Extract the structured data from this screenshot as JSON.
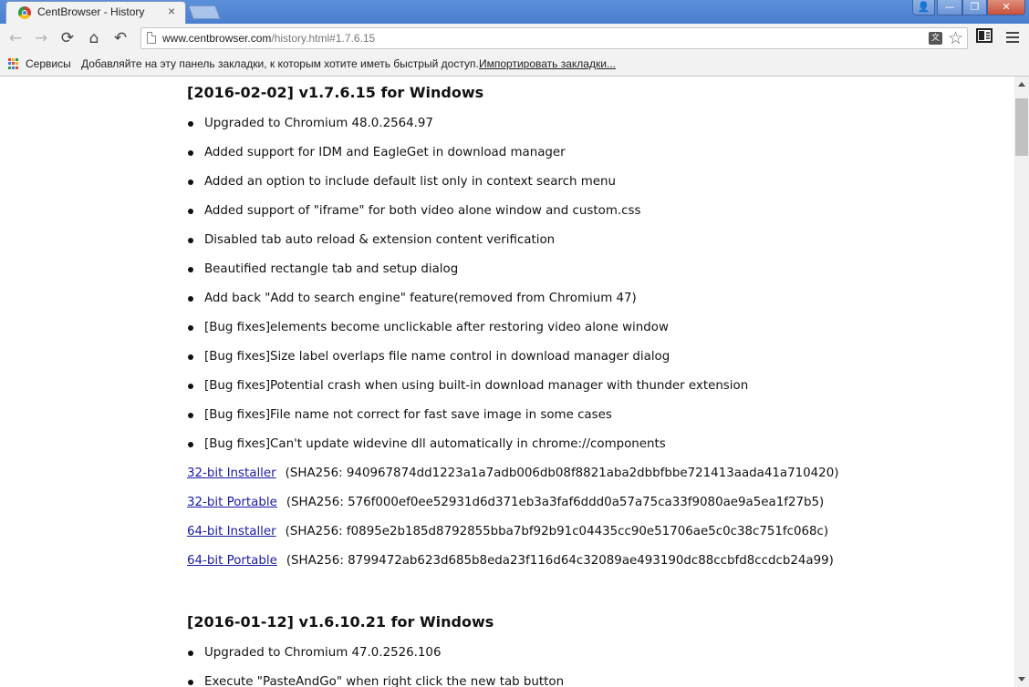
{
  "window": {
    "tab_title": "CentBrowser - History",
    "tab_close": "×",
    "buttons": {
      "user": "👤",
      "minimize": "—",
      "maximize": "❐",
      "close": "✕"
    }
  },
  "toolbar": {
    "back": "←",
    "forward": "→",
    "reload": "⟳",
    "home": "⌂",
    "undo_close_tab": "↶",
    "url_host": "www.centbrowser.com",
    "url_path": "/history.html#1.7.6.15",
    "translate_glyph": "文",
    "star": "☆"
  },
  "bookmarks": {
    "apps_label": "Сервисы",
    "hint": "Добавляйте на эту панель закладки, к которым хотите иметь быстрый доступ.",
    "import_link": "Импортировать закладки..."
  },
  "releases": [
    {
      "title": "[2016-02-02] v1.7.6.15 for Windows",
      "notes": [
        "Upgraded to Chromium 48.0.2564.97",
        "Added support for IDM and EagleGet in download manager",
        "Added an option to include default list only in context search menu",
        "Added support of \"iframe\" for both video alone window and custom.css",
        "Disabled tab auto reload & extension content verification",
        "Beautified rectangle tab and setup dialog",
        "Add back \"Add to search engine\" feature(removed from Chromium 47)",
        "[Bug fixes]elements become unclickable after restoring video alone window",
        "[Bug fixes]Size label overlaps file name control in download manager dialog",
        "[Bug fixes]Potential crash when using built-in download manager with thunder extension",
        "[Bug fixes]File name not correct for fast save image in some cases",
        "[Bug fixes]Can't update widevine dll automatically in chrome://components"
      ],
      "downloads": [
        {
          "label": "32-bit Installer",
          "sha": "(SHA256: 940967874dd1223a1a7adb006db08f8821aba2dbbfbbe721413aada41a710420)"
        },
        {
          "label": "32-bit Portable",
          "sha": "(SHA256: 576f000ef0ee52931d6d371eb3a3faf6ddd0a57a75ca33f9080ae9a5ea1f27b5)"
        },
        {
          "label": "64-bit Installer",
          "sha": "(SHA256: f0895e2b185d8792855bba7bf92b91c04435cc90e51706ae5c0c38c751fc068c)"
        },
        {
          "label": "64-bit Portable",
          "sha": "(SHA256: 8799472ab623d685b8eda23f116d64c32089ae493190dc88ccbfd8ccdcb24a99)"
        }
      ]
    },
    {
      "title": "[2016-01-12] v1.6.10.21 for Windows",
      "notes": [
        "Upgraded to Chromium 47.0.2526.106",
        "Execute \"PasteAndGo\" when right click the new tab button"
      ]
    }
  ],
  "colors": {
    "title_bar": "#4a7fd0",
    "link": "#1a1aa6",
    "apps_grid": [
      "#e0452f",
      "#f6b21a",
      "#2f9a45",
      "#3b7be0",
      "#e0452f",
      "#f6b21a",
      "#2f9a45",
      "#3b7be0",
      "#e0452f"
    ]
  }
}
